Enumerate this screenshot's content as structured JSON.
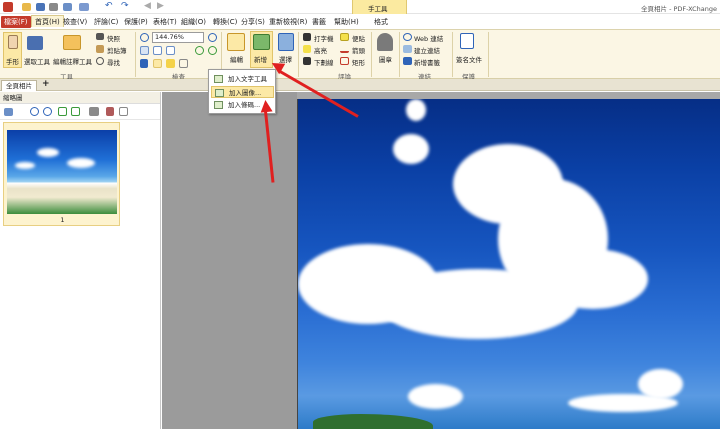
{
  "window": {
    "title": "全頁相片 - PDF-XChange",
    "context_tab_group": "手工具",
    "context_tab": "格式"
  },
  "menu": {
    "file": "檔案(F)",
    "items": [
      "首頁(H)",
      "檢查(V)",
      "評論(C)",
      "保護(P)",
      "表格(T)",
      "組織(O)",
      "轉換(C)",
      "分享(S)",
      "重新檢視(R)",
      "書籤",
      "幫助(H)"
    ]
  },
  "ribbon": {
    "tools": {
      "hand": "手形",
      "select_text": "選取工具",
      "edit_annotation": "編輯註釋工具",
      "snapshot": "快照",
      "clipboard": "剪貼簿",
      "find": "尋找",
      "group_label": "工具"
    },
    "view": {
      "zoom_value": "144.76%",
      "group_label": "檢查"
    },
    "objects": {
      "edit": "編輯",
      "add": "新增",
      "select": "選擇"
    },
    "comments": {
      "typewriter": "打字機",
      "sticky_note": "便貼",
      "highlight": "高亮",
      "arrow": "箭頭",
      "underline": "下劃線",
      "rectangle": "矩形",
      "group_label": "評論"
    },
    "stamp": "圖章",
    "links": {
      "web_link": "Web 連結",
      "create_link": "建立連結",
      "new_bookmark": "新增書籤",
      "group_label": "連結"
    },
    "protect": {
      "sign_document": "簽名文件",
      "group_label": "保護"
    }
  },
  "tabs": {
    "document": "全頁相片",
    "add": "+"
  },
  "sidebar": {
    "title": "縮略圖",
    "pages": [
      {
        "number": "1"
      }
    ]
  },
  "dropdown": {
    "items": [
      {
        "label": "加入文字工具",
        "highlighted": false
      },
      {
        "label": "加入圖像...",
        "highlighted": true
      },
      {
        "label": "加入條碼...",
        "highlighted": false
      }
    ]
  },
  "colors": {
    "accent": "#c43a2b",
    "ribbon_bg": "#fbf6e4",
    "highlight": "#fce9a6",
    "arrow": "#e02020"
  }
}
